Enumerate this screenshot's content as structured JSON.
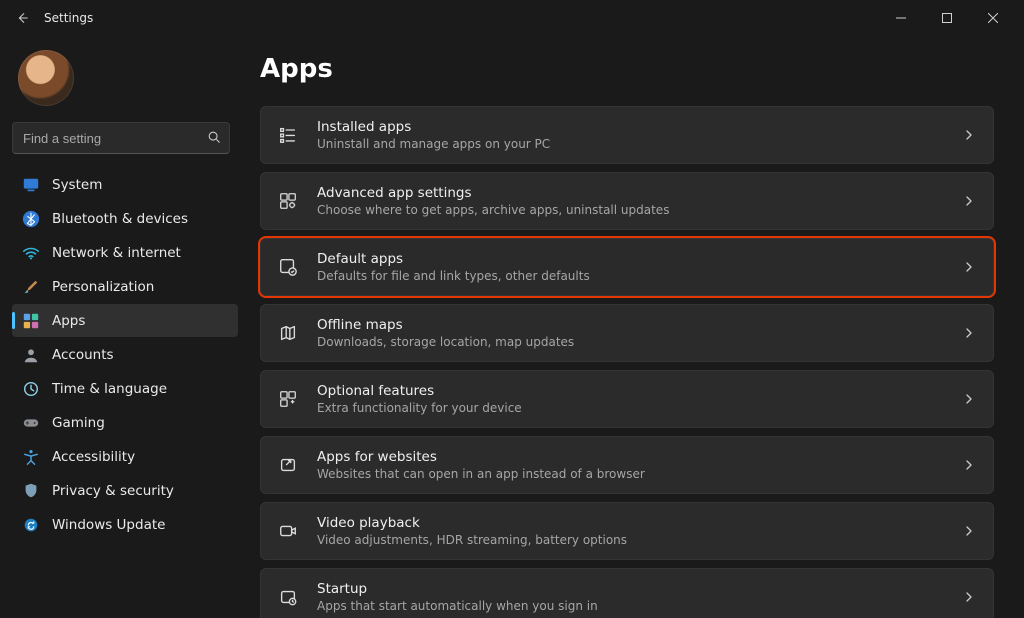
{
  "window": {
    "title": "Settings"
  },
  "search": {
    "placeholder": "Find a setting"
  },
  "sidebar": {
    "items": [
      {
        "label": "System",
        "icon": "display-icon"
      },
      {
        "label": "Bluetooth & devices",
        "icon": "bluetooth-icon"
      },
      {
        "label": "Network & internet",
        "icon": "wifi-icon"
      },
      {
        "label": "Personalization",
        "icon": "brush-icon"
      },
      {
        "label": "Apps",
        "icon": "apps-icon"
      },
      {
        "label": "Accounts",
        "icon": "account-icon"
      },
      {
        "label": "Time & language",
        "icon": "clock-icon"
      },
      {
        "label": "Gaming",
        "icon": "gamepad-icon"
      },
      {
        "label": "Accessibility",
        "icon": "accessibility-icon"
      },
      {
        "label": "Privacy & security",
        "icon": "shield-icon"
      },
      {
        "label": "Windows Update",
        "icon": "update-icon"
      }
    ],
    "active_index": 4
  },
  "page": {
    "title": "Apps",
    "items": [
      {
        "title": "Installed apps",
        "subtitle": "Uninstall and manage apps on your PC",
        "icon": "list-icon"
      },
      {
        "title": "Advanced app settings",
        "subtitle": "Choose where to get apps, archive apps, uninstall updates",
        "icon": "app-settings-icon"
      },
      {
        "title": "Default apps",
        "subtitle": "Defaults for file and link types, other defaults",
        "icon": "default-app-icon",
        "highlight": true
      },
      {
        "title": "Offline maps",
        "subtitle": "Downloads, storage location, map updates",
        "icon": "map-icon"
      },
      {
        "title": "Optional features",
        "subtitle": "Extra functionality for your device",
        "icon": "puzzle-icon"
      },
      {
        "title": "Apps for websites",
        "subtitle": "Websites that can open in an app instead of a browser",
        "icon": "open-app-icon"
      },
      {
        "title": "Video playback",
        "subtitle": "Video adjustments, HDR streaming, battery options",
        "icon": "video-icon"
      },
      {
        "title": "Startup",
        "subtitle": "Apps that start automatically when you sign in",
        "icon": "startup-icon"
      }
    ]
  }
}
